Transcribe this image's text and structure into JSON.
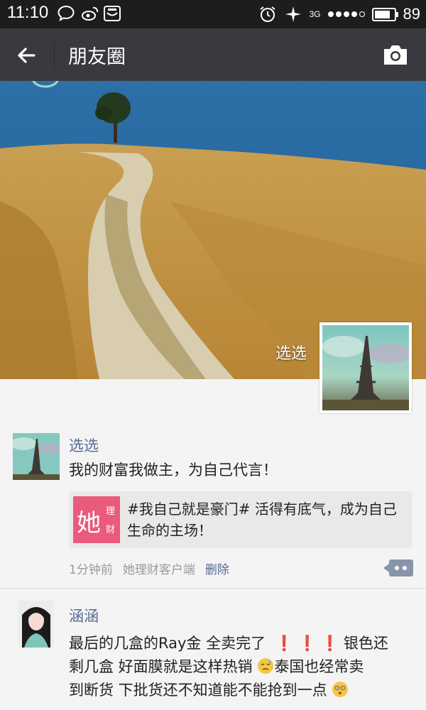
{
  "status_bar": {
    "time": "11:10",
    "network": "3G",
    "battery": "89",
    "battery_level": 0.89
  },
  "nav": {
    "title": "朋友圈",
    "back_icon": "back-arrow-icon",
    "camera_icon": "camera-icon"
  },
  "cover": {
    "name": "选选"
  },
  "posts": [
    {
      "author": "选选",
      "text": "我的财富我做主，为自己代言！",
      "link": {
        "icon_big": "她",
        "icon_small_1": "理",
        "icon_small_2": "财",
        "text": "#我自己就是豪门# 活得有底气，成为自己生命的主场！"
      },
      "time": "1分钟前",
      "source": "她理财客户端",
      "delete": "删除"
    },
    {
      "author": "涵涵",
      "line1_a": "最后的几盒的Ray金 全卖完了",
      "line1_b": "银色还",
      "line2_a": "剩几盒 好面膜就是这样热销",
      "line2_b": "泰国也经常卖",
      "line3": "到断货 下批货还不知道能不能抢到一点"
    }
  ],
  "colors": {
    "status_bar": "#1d1d1d",
    "nav_bar": "#393a3f",
    "author_link": "#576b95",
    "meta_gray": "#9a9a9a"
  }
}
